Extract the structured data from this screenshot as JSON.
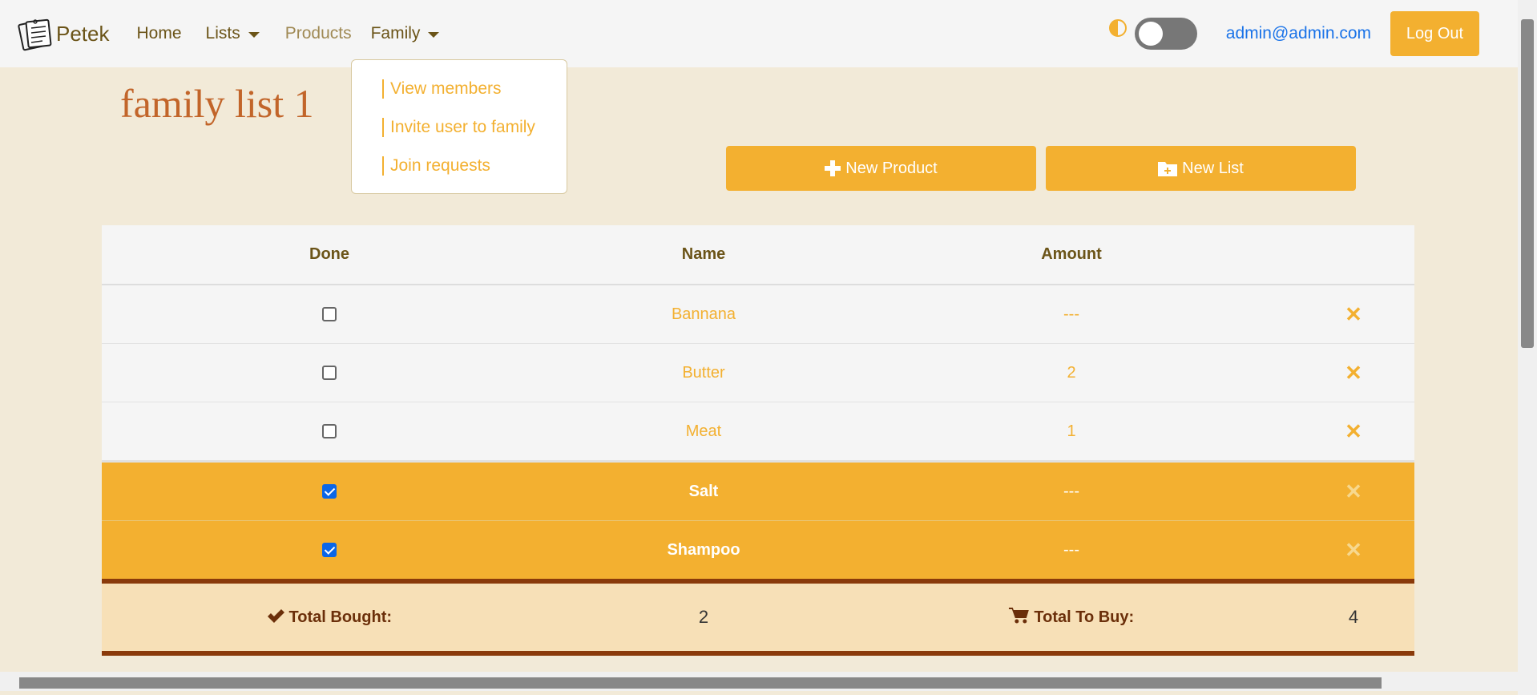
{
  "nav": {
    "brand": "Petek",
    "items": [
      {
        "label": "Home"
      },
      {
        "label": "Lists"
      },
      {
        "label": "Products"
      },
      {
        "label": "Family"
      }
    ],
    "user_email": "admin@admin.com",
    "logout_label": "Log Out"
  },
  "family_dropdown": {
    "items": [
      "View members",
      "Invite user to family",
      "Join requests"
    ]
  },
  "page": {
    "title": "family list 1",
    "new_product_label": "New Product",
    "new_list_label": "New List"
  },
  "table": {
    "headers": [
      "Done",
      "Name",
      "Amount"
    ],
    "rows": [
      {
        "name": "Bannana",
        "amount": "---",
        "done": false
      },
      {
        "name": "Butter",
        "amount": "2",
        "done": false
      },
      {
        "name": "Meat",
        "amount": "1",
        "done": false
      },
      {
        "name": "Salt",
        "amount": "---",
        "done": true
      },
      {
        "name": "Shampoo",
        "amount": "---",
        "done": true
      }
    ],
    "delete_symbol": "✕",
    "summary": {
      "bought_label": "Total Bought:",
      "bought_value": "2",
      "to_buy_label": "Total To Buy:",
      "to_buy_value": "4"
    }
  },
  "colors": {
    "accent": "#f3b030",
    "brand_text": "#6b5418",
    "title": "#c2652a",
    "summary_border": "#8a3a0a"
  }
}
